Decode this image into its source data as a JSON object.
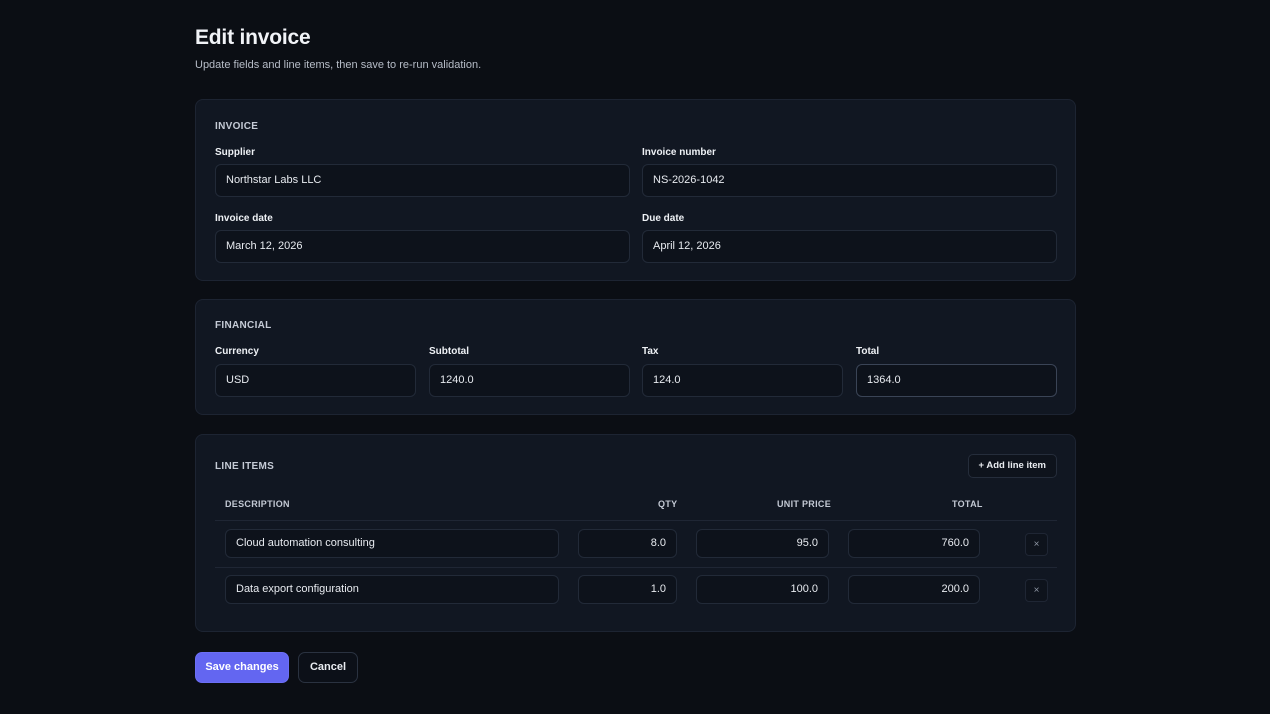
{
  "header": {
    "title": "Edit invoice",
    "subtitle": "Update fields and line items, then save to re-run validation."
  },
  "invoice": {
    "section_title": "INVOICE",
    "supplier": {
      "label": "Supplier",
      "value": "Northstar Labs LLC"
    },
    "invoice_number": {
      "label": "Invoice number",
      "value": "NS-2026-1042"
    },
    "invoice_date": {
      "label": "Invoice date",
      "value": "March 12, 2026"
    },
    "due_date": {
      "label": "Due date",
      "value": "April 12, 2026"
    }
  },
  "financial": {
    "section_title": "FINANCIAL",
    "currency": {
      "label": "Currency",
      "value": "USD"
    },
    "subtotal": {
      "label": "Subtotal",
      "value": "1240.0"
    },
    "tax": {
      "label": "Tax",
      "value": "124.0"
    },
    "total": {
      "label": "Total",
      "value": "1364.0"
    }
  },
  "line_items": {
    "section_title": "LINE ITEMS",
    "add_label": "+ Add line item",
    "columns": {
      "description": "DESCRIPTION",
      "qty": "QTY",
      "unit_price": "UNIT PRICE",
      "total": "TOTAL"
    },
    "rows": [
      {
        "description": "Cloud automation consulting",
        "qty": "8.0",
        "unit_price": "95.0",
        "total": "760.0",
        "remove_label": "×"
      },
      {
        "description": "Data export configuration",
        "qty": "1.0",
        "unit_price": "100.0",
        "total": "200.0",
        "remove_label": "×"
      }
    ]
  },
  "actions": {
    "save_label": "Save changes",
    "cancel_label": "Cancel",
    "primary_color": "#6366f1"
  }
}
